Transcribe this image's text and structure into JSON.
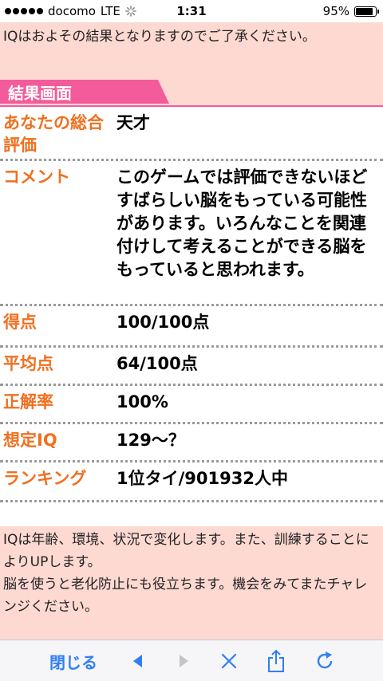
{
  "status": {
    "carrier": "docomo",
    "network": "LTE",
    "time": "1:31",
    "battery": "95%",
    "battery_level": 0.95
  },
  "notice_top": "IQはおよその結果となりますのでご了承ください。",
  "result_header": "結果画面",
  "results": [
    {
      "label": "あなたの総合評価",
      "value": "天才"
    },
    {
      "label": "コメント",
      "value": "このゲームでは評価できないほどすばらしい脳をもっている可能性があります。いろんなことを関連付けして考えることができる脳をもっていると思われます。"
    },
    {
      "label": "得点",
      "value": "100/100点"
    },
    {
      "label": "平均点",
      "value": "64/100点"
    },
    {
      "label": "正解率",
      "value": "100%"
    },
    {
      "label": "想定IQ",
      "value": "129〜？"
    },
    {
      "label": "ランキング",
      "value": "1位タイ/901932人中"
    }
  ],
  "notice_bottom": {
    "line1": "IQは年齢、環境、状況で変化します。また、訓練することによりUPします。",
    "line2": "脳を使うと老化防止にも役立ちます。機会をみてまたチャレンジください。"
  },
  "toolbar": {
    "close_label": "閉じる",
    "accent_color": "#2f7ef6"
  },
  "colors": {
    "pink_bg": "#fdd9d2",
    "tab_pink": "#f35b9a",
    "label_orange": "#f07020"
  }
}
